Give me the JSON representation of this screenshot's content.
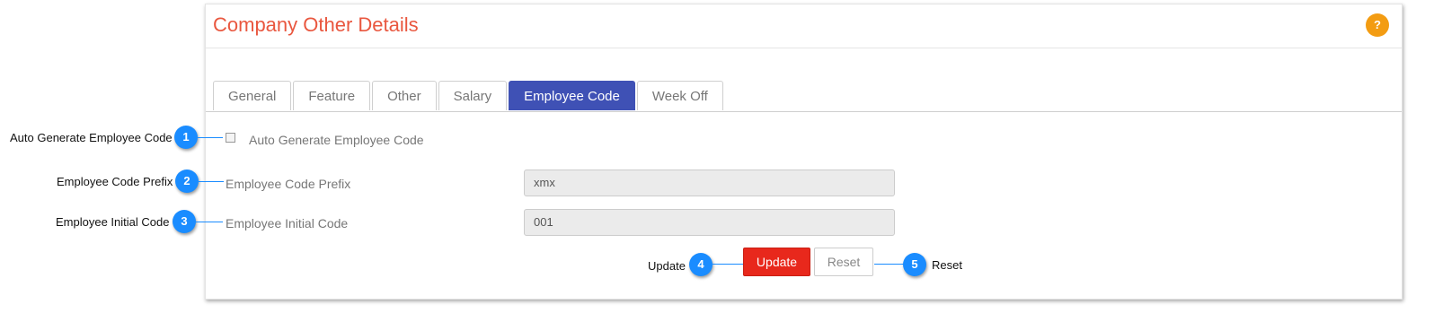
{
  "panel": {
    "title": "Company Other Details",
    "help_label": "?"
  },
  "tabs": [
    {
      "label": "General",
      "active": false
    },
    {
      "label": "Feature",
      "active": false
    },
    {
      "label": "Other",
      "active": false
    },
    {
      "label": "Salary",
      "active": false
    },
    {
      "label": "Employee Code",
      "active": true
    },
    {
      "label": "Week Off",
      "active": false
    }
  ],
  "form": {
    "auto_generate_label": "Auto Generate Employee Code",
    "auto_generate_checked": false,
    "prefix_label": "Employee Code Prefix",
    "prefix_value": "xmx",
    "initial_label": "Employee Initial Code",
    "initial_value": "001",
    "update_label": "Update",
    "reset_label": "Reset"
  },
  "callouts": [
    {
      "number": "1",
      "text": "Auto Generate Employee Code"
    },
    {
      "number": "2",
      "text": "Employee Code Prefix"
    },
    {
      "number": "3",
      "text": "Employee Initial Code"
    },
    {
      "number": "4",
      "text": "Update"
    },
    {
      "number": "5",
      "text": "Reset"
    }
  ],
  "colors": {
    "title": "#e9573f",
    "active_tab": "#3f51b5",
    "update_button": "#e8281c",
    "help_badge": "#f39c12",
    "callout_badge": "#1a8cff"
  }
}
